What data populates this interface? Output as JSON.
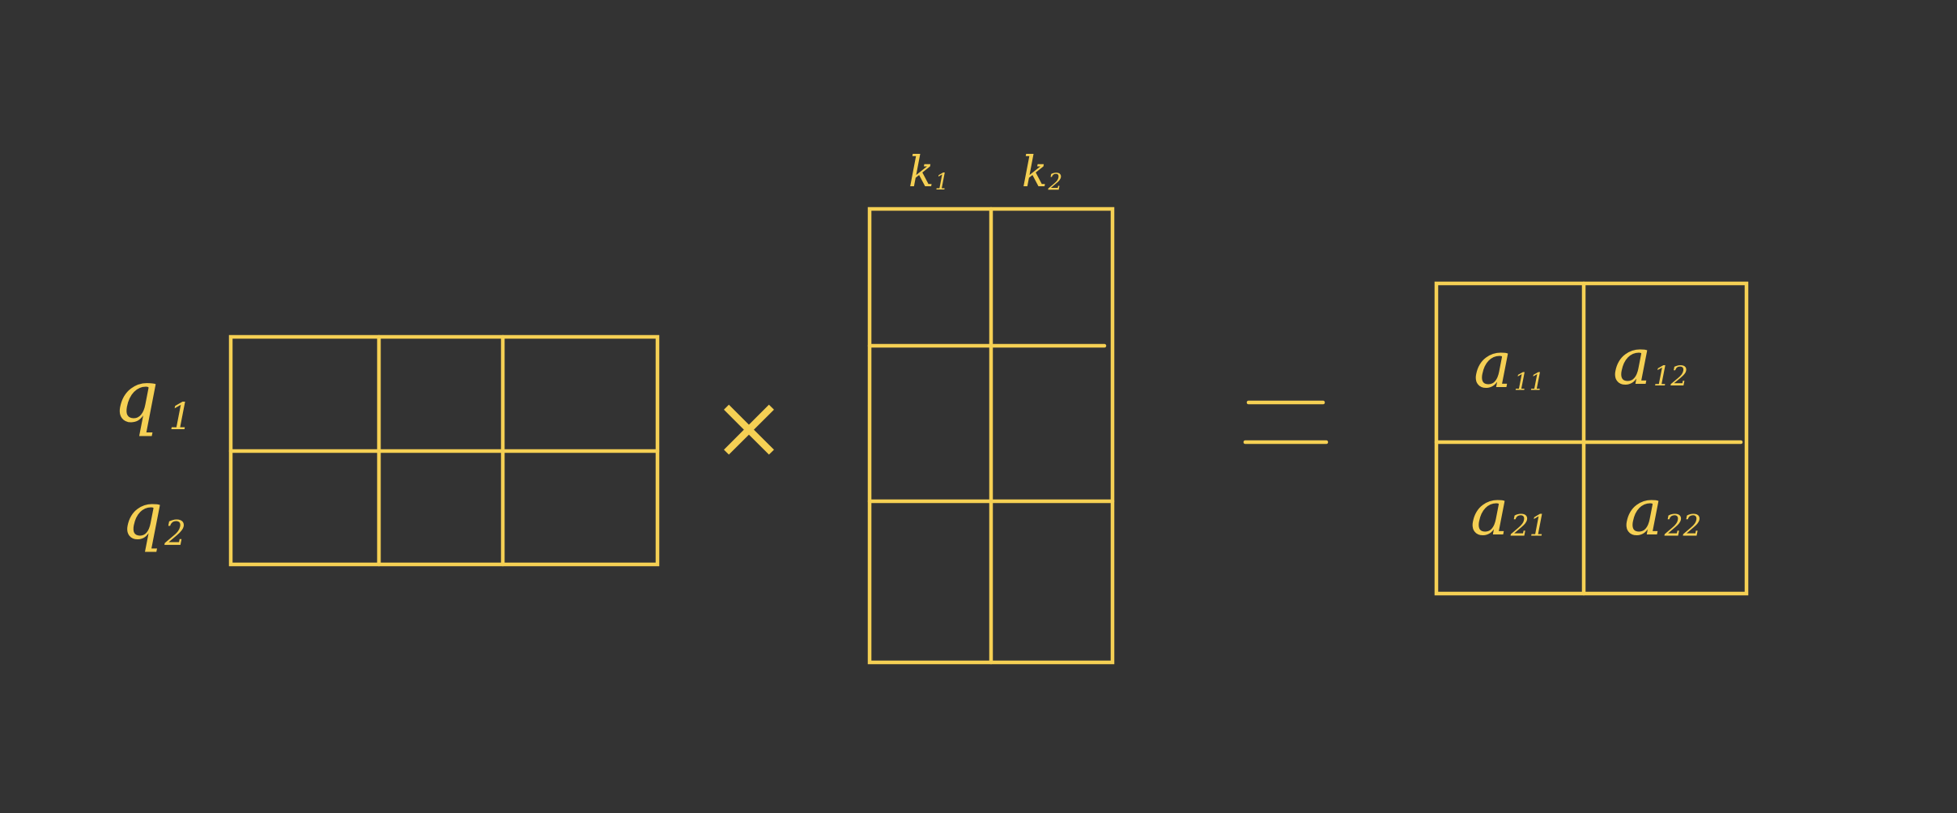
{
  "colors": {
    "background": "#333333",
    "ink": "#f5d054"
  },
  "matrix_q": {
    "row_labels": [
      {
        "letter": "q",
        "sub": "1"
      },
      {
        "letter": "q",
        "sub": "2"
      }
    ],
    "rows": 2,
    "cols": 3
  },
  "operator_times": "×",
  "matrix_k": {
    "col_labels": [
      {
        "letter": "k",
        "sub": "1"
      },
      {
        "letter": "k",
        "sub": "2"
      }
    ],
    "rows": 3,
    "cols": 2
  },
  "operator_equals": "=",
  "matrix_a": {
    "cells": [
      [
        {
          "letter": "a",
          "sub": "11"
        },
        {
          "letter": "a",
          "sub": "12"
        }
      ],
      [
        {
          "letter": "a",
          "sub": "21"
        },
        {
          "letter": "a",
          "sub": "22"
        }
      ]
    ]
  }
}
